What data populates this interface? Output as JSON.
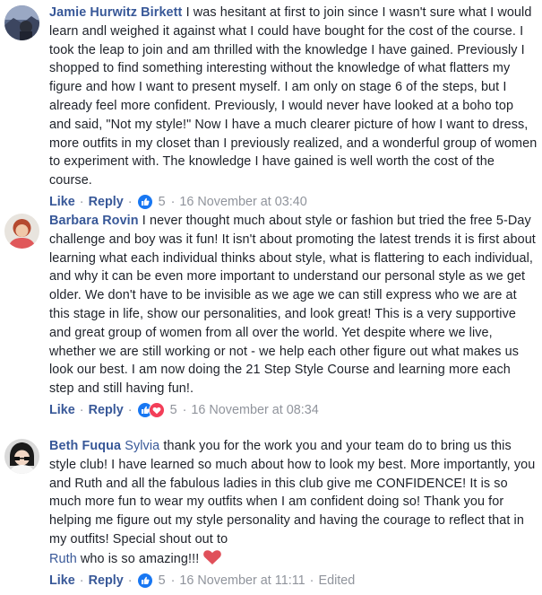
{
  "comments": [
    {
      "author": "Jamie Hurwitz Birkett",
      "text": "I was hesitant at first to join since I wasn't sure what I would learn andl weighed it against what I could have bought for the cost of the course. I took the leap to join and am thrilled with the knowledge I have gained. Previously I shopped to find something interesting without the knowledge of what flatters my figure and how I want to present myself. I am only on stage 6 of the steps, but I already feel more confident. Previously, I would never have looked at a boho top and said, \"Not my style!\" Now I have a much clearer picture of how I want to dress, more outfits in my closet than I previously realized, and a wonderful group of women to experiment with. The knowledge I have gained is well worth the cost of the course.",
      "like_label": "Like",
      "reply_label": "Reply",
      "reaction_icons": [
        "like-reaction-icon"
      ],
      "reaction_count": "5",
      "timestamp": "16 November at 03:40"
    },
    {
      "author": "Barbara Rovin",
      "text": "I never thought much about style or fashion but tried the free 5-Day challenge and boy was it fun! It isn't about promoting the latest trends it is first about learning what each individual thinks about style, what is flattering to each individual, and why it can be even more important to understand our personal style as we get older. We don't have to be invisible as we age we can still express who we are at this stage in life, show our personalities, and look great! This is a very supportive and great group of women from all over the world. Yet despite where we live, whether we are still working or not - we help each other figure out what makes us look our best. I am now doing the 21 Step Style Course and learning more each step and still having fun!.",
      "like_label": "Like",
      "reply_label": "Reply",
      "reaction_icons": [
        "like-reaction-icon",
        "love-reaction-icon"
      ],
      "reaction_count": "5",
      "timestamp": "16 November at 08:34"
    },
    {
      "author": "Beth Fuqua",
      "tag": "Sylvia",
      "text": "thank you for the work you and your team do to bring us this style club! I have learned so much about how to look my best. More importantly, you and Ruth and all the fabulous ladies in this club give me CONFIDENCE! It is so much more fun to wear my outfits when I am confident doing so! Thank you for helping me figure out my style personality and having the courage to reflect that in my outfits! Special shout out to",
      "tag2": "Ruth",
      "text_end": "who is so amazing!!!",
      "like_label": "Like",
      "reply_label": "Reply",
      "reaction_icons": [
        "like-reaction-icon"
      ],
      "reaction_count": "5",
      "timestamp": "16 November at 11:11",
      "edited_label": "Edited"
    }
  ],
  "colors": {
    "link": "#385898",
    "meta": "#90949c",
    "text": "#1d2129",
    "like_reaction": "#1877f2",
    "love_reaction": "#f33e58",
    "heart_emoji": "#e0505a"
  },
  "separator": "·"
}
